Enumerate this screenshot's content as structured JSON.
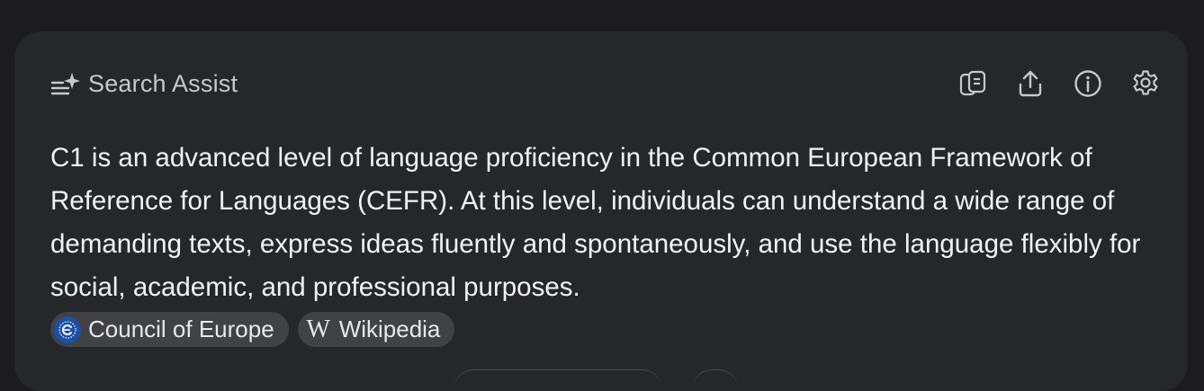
{
  "panel": {
    "title": "Search Assist",
    "title_icon": "sparkle-list-icon",
    "actions": [
      {
        "name": "copy-button",
        "icon": "copy-icon"
      },
      {
        "name": "share-button",
        "icon": "share-icon"
      },
      {
        "name": "info-button",
        "icon": "info-icon"
      },
      {
        "name": "settings-button",
        "icon": "gear-icon"
      }
    ]
  },
  "answer": {
    "text": "C1 is an advanced level of language proficiency in the Common European Framework of Reference for Languages (CEFR). At this level, individuals can understand a wide range of demanding texts, express ideas fluently and spontaneously, and use the language flexibly for social, academic, and professional purposes."
  },
  "sources": [
    {
      "label": "Council of Europe",
      "icon": "council-of-europe-logo"
    },
    {
      "label": "Wikipedia",
      "icon": "wikipedia-logo",
      "icon_glyph": "W"
    }
  ],
  "colors": {
    "page_background": "#1c1c1e",
    "card_background": "#26272b",
    "chip_background": "#414246",
    "text_primary": "#f2f2f4",
    "text_secondary": "#c7c8cc"
  }
}
